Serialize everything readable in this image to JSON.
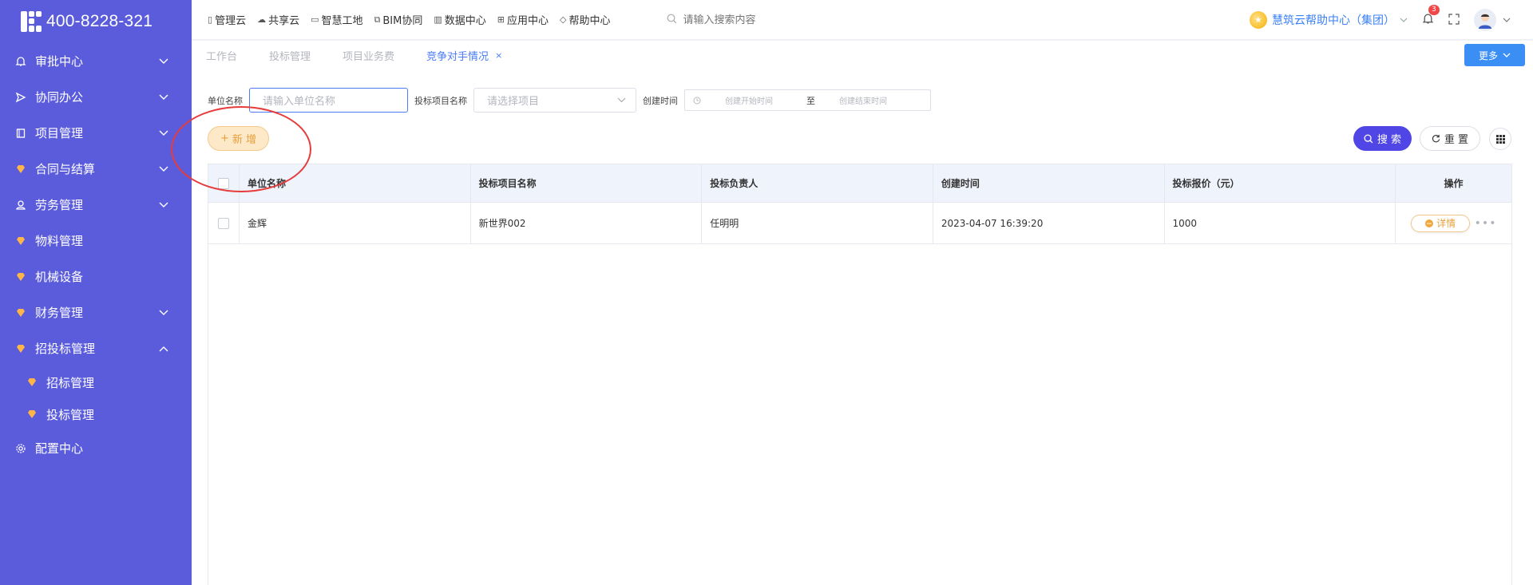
{
  "sidebar": {
    "phone": "400-8228-321",
    "items": [
      {
        "label": "审批中心",
        "icon": "bell-icon"
      },
      {
        "label": "协同办公",
        "icon": "send-icon"
      },
      {
        "label": "项目管理",
        "icon": "book-icon"
      },
      {
        "label": "合同与结算",
        "icon": "gem-icon"
      },
      {
        "label": "劳务管理",
        "icon": "user-icon"
      },
      {
        "label": "物料管理",
        "icon": "gem-icon"
      },
      {
        "label": "机械设备",
        "icon": "gem-icon"
      },
      {
        "label": "财务管理",
        "icon": "gem-icon"
      },
      {
        "label": "招投标管理",
        "icon": "gem-icon"
      },
      {
        "label": "招标管理",
        "icon": "gem-icon"
      },
      {
        "label": "投标管理",
        "icon": "gem-icon"
      },
      {
        "label": "配置中心",
        "icon": "gear-icon"
      }
    ]
  },
  "topnav": {
    "items": [
      "管理云",
      "共享云",
      "智慧工地",
      "BIM协同",
      "数据中心",
      "应用中心",
      "帮助中心"
    ],
    "search_placeholder": "请输入搜索内容",
    "org_name": "慧筑云帮助中心（集团）",
    "notification_count": "3"
  },
  "tabs": {
    "items": [
      "工作台",
      "投标管理",
      "项目业务费",
      "竞争对手情况"
    ],
    "close": "×",
    "more_label": "更多"
  },
  "filters": {
    "unit_label": "单位名称",
    "unit_placeholder": "请输入单位名称",
    "project_label": "投标项目名称",
    "project_placeholder": "请选择项目",
    "date_label": "创建时间",
    "date_start_placeholder": "创建开始时间",
    "date_sep": "至",
    "date_end_placeholder": "创建结束时间"
  },
  "actions": {
    "add_label": "新 增",
    "search_label": "搜 索",
    "reset_label": "重 置"
  },
  "table": {
    "columns": [
      "单位名称",
      "投标项目名称",
      "投标负责人",
      "创建时间",
      "投标报价（元）",
      "操作"
    ],
    "rows": [
      {
        "unit": "金辉",
        "project": "新世界002",
        "owner": "任明明",
        "created": "2023-04-07 16:39:20",
        "price": "1000",
        "action": "详情"
      }
    ]
  },
  "colors": {
    "sidebar_bg": "#5b5cdc",
    "accent": "#4a7cf6",
    "search_btn": "#5046e5",
    "add_btn": "#fde8c8",
    "annotation": "#e63c3c"
  }
}
